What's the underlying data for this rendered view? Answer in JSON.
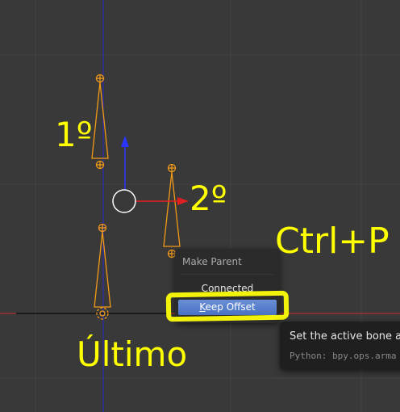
{
  "viewport": {
    "background": "#393939",
    "bone_color": "#f29a18",
    "x_axis_color": "#cc2a2a",
    "y_axis_color": "#2a2ac8",
    "manipulator_y_color": "#2b35ff",
    "manipulator_x_color": "#e02020"
  },
  "annotations": {
    "first": "1º",
    "second": "2º",
    "shortcut": "Ctrl+P",
    "last": "Último",
    "color": "#ffff00"
  },
  "menu": {
    "title": "Make Parent",
    "items": [
      {
        "underline": "C",
        "rest": "onnected",
        "active": false
      },
      {
        "underline": "K",
        "rest": "eep Offset",
        "active": true
      }
    ]
  },
  "tooltip": {
    "text": "Set the active bone as",
    "python": "Python: bpy.ops.arma"
  },
  "highlight_color": "#f2f20a"
}
